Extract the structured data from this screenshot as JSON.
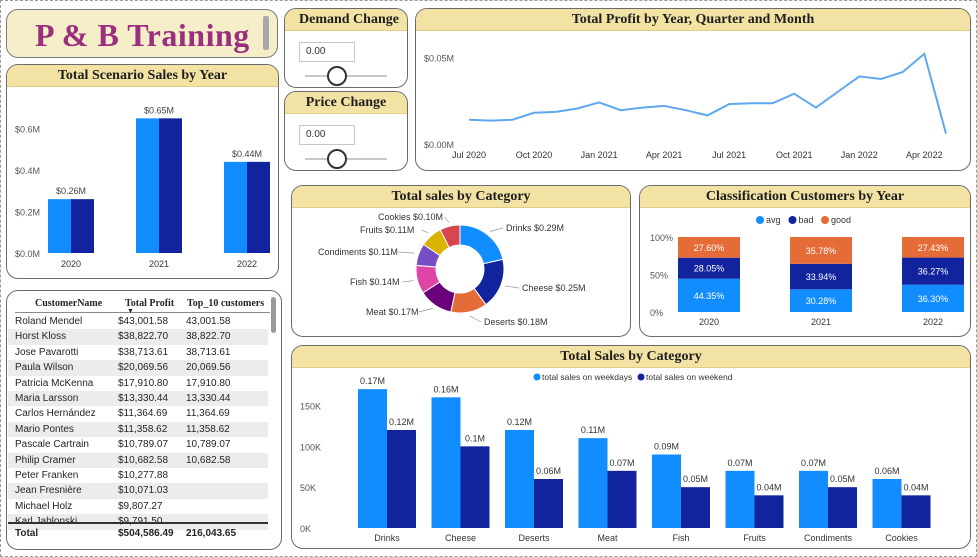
{
  "report_title": "P & B Training",
  "params": {
    "demand": {
      "title": "Demand Change",
      "value": "0.00"
    },
    "price": {
      "title": "Price Change",
      "value": "0.00"
    }
  },
  "scenario": {
    "title": "Total Scenario Sales by Year",
    "yticks": [
      "$0.6M",
      "$0.4M",
      "$0.2M",
      "$0.0M"
    ]
  },
  "profit": {
    "title": "Total Profit by Year, Quarter and Month",
    "yticks": [
      "$0.05M",
      "$0.00M"
    ],
    "xticks": [
      "Jul 2020",
      "Oct 2020",
      "Jan 2021",
      "Apr 2021",
      "Jul 2021",
      "Oct 2021",
      "Jan 2022",
      "Apr 2022"
    ]
  },
  "category_donut": {
    "title": "Total sales by Category"
  },
  "classification": {
    "title": "Classification Customers by Year",
    "yticks": [
      "100%",
      "50%",
      "0%"
    ]
  },
  "sales_category": {
    "title": "Total Sales by Category",
    "yticks": [
      "150K",
      "100K",
      "50K",
      "0K"
    ]
  },
  "table": {
    "headers": [
      "CustomerName",
      "Total Profit",
      "Top_10 customers"
    ],
    "rows": [
      [
        "Roland Mendel",
        "$43,001.58",
        "43,001.58"
      ],
      [
        "Horst Kloss",
        "$38,822.70",
        "38,822.70"
      ],
      [
        "Jose Pavarotti",
        "$38,713.61",
        "38,713.61"
      ],
      [
        "Paula Wilson",
        "$20,069.56",
        "20,069.56"
      ],
      [
        "Patricia McKenna",
        "$17,910.80",
        "17,910.80"
      ],
      [
        "Maria Larsson",
        "$13,330.44",
        "13,330.44"
      ],
      [
        "Carlos Hernández",
        "$11,364.69",
        "11,364.69"
      ],
      [
        "Mario Pontes",
        "$11,358.62",
        "11,358.62"
      ],
      [
        "Pascale Cartrain",
        "$10,789.07",
        "10,789.07"
      ],
      [
        "Philip Cramer",
        "$10,682.58",
        "10,682.58"
      ],
      [
        "Peter Franken",
        "$10,277.88",
        ""
      ],
      [
        "Jean Fresnière",
        "$10,071.03",
        ""
      ],
      [
        "Michael Holz",
        "$9,807.27",
        ""
      ],
      [
        "Karl Jablonski",
        "$9,791.50",
        ""
      ]
    ],
    "total": [
      "Total",
      "$504,586.49",
      "216,043.65"
    ]
  },
  "chart_data": [
    {
      "type": "bar",
      "title": "Total Scenario Sales by Year",
      "categories": [
        "2020",
        "2021",
        "2022"
      ],
      "series": [
        {
          "values": [
            0.26,
            0.65,
            0.44
          ],
          "color": "#118dff"
        },
        {
          "values": [
            0.26,
            0.65,
            0.44
          ],
          "color": "#12239e"
        }
      ],
      "data_labels": [
        "$0.26M",
        "$0.65M",
        "$0.44M"
      ],
      "ylim": [
        0,
        0.7
      ]
    },
    {
      "type": "line",
      "title": "Total Profit by Year, Quarter and Month",
      "x": [
        "2020-07",
        "2020-08",
        "2020-09",
        "2020-10",
        "2020-11",
        "2020-12",
        "2021-01",
        "2021-02",
        "2021-03",
        "2021-04",
        "2021-05",
        "2021-06",
        "2021-07",
        "2021-08",
        "2021-09",
        "2021-10",
        "2021-11",
        "2021-12",
        "2022-01",
        "2022-02",
        "2022-03",
        "2022-04",
        "2022-05"
      ],
      "values": [
        0.014,
        0.0135,
        0.014,
        0.018,
        0.0185,
        0.0205,
        0.024,
        0.0195,
        0.021,
        0.022,
        0.0195,
        0.0165,
        0.023,
        0.0235,
        0.0235,
        0.029,
        0.021,
        0.03,
        0.039,
        0.0375,
        0.0415,
        0.052,
        0.006
      ],
      "ylim": [
        0,
        0.06
      ],
      "color": "#5fa8f0"
    },
    {
      "type": "pie",
      "title": "Total sales by Category",
      "labels": [
        "Drinks",
        "Cheese",
        "Deserts",
        "Meat",
        "Fish",
        "Condiments",
        "Fruits",
        "Cookies"
      ],
      "values": [
        0.29,
        0.25,
        0.18,
        0.17,
        0.14,
        0.11,
        0.11,
        0.1
      ],
      "data_labels": [
        "Drinks $0.29M",
        "Cheese $0.25M",
        "Deserts $0.18M",
        "Meat $0.17M",
        "Fish $0.14M",
        "Condiments $0.11M",
        "Fruits $0.11M",
        "Cookies $0.10M"
      ],
      "colors": [
        "#118dff",
        "#12239e",
        "#e66c37",
        "#6b007b",
        "#e044a7",
        "#744ec2",
        "#d9b300",
        "#d64550"
      ]
    },
    {
      "type": "bar",
      "stacked": "100%",
      "title": "Classification Customers by Year",
      "categories": [
        "2020",
        "2021",
        "2022"
      ],
      "series": [
        {
          "name": "avg",
          "values": [
            44.35,
            30.28,
            36.3
          ],
          "color": "#118dff"
        },
        {
          "name": "bad",
          "values": [
            28.05,
            33.94,
            36.27
          ],
          "color": "#12239e"
        },
        {
          "name": "good",
          "values": [
            27.6,
            35.78,
            27.43
          ],
          "color": "#e66c37"
        }
      ],
      "data_labels": {
        "avg": [
          "44.35%",
          "30.28%",
          "36.30%"
        ],
        "bad": [
          "28.05%",
          "33.94%",
          "36.27%"
        ],
        "good": [
          "27.60%",
          "35.78%",
          "27.43%"
        ]
      },
      "legend": "top-center"
    },
    {
      "type": "bar",
      "title": "Total Sales by Category",
      "categories": [
        "Drinks",
        "Cheese",
        "Deserts",
        "Meat",
        "Fish",
        "Fruits",
        "Condiments",
        "Cookies"
      ],
      "series": [
        {
          "name": "total sales on weekdays",
          "values": [
            170000,
            160000,
            120000,
            110000,
            90000,
            70000,
            70000,
            60000
          ],
          "color": "#118dff"
        },
        {
          "name": "total sales on weekend",
          "values": [
            120000,
            100000,
            60000,
            70000,
            50000,
            40000,
            50000,
            40000
          ],
          "color": "#12239e"
        }
      ],
      "data_labels": {
        "weekdays": [
          "0.17M",
          "0.16M",
          "0.12M",
          "0.11M",
          "0.09M",
          "0.07M",
          "0.07M",
          "0.06M"
        ],
        "weekend": [
          "0.12M",
          "0.1M",
          "0.06M",
          "0.07M",
          "0.05M",
          "0.04M",
          "0.05M",
          "0.04M"
        ]
      },
      "ylim": [
        0,
        180000
      ],
      "legend": "top-center"
    }
  ]
}
